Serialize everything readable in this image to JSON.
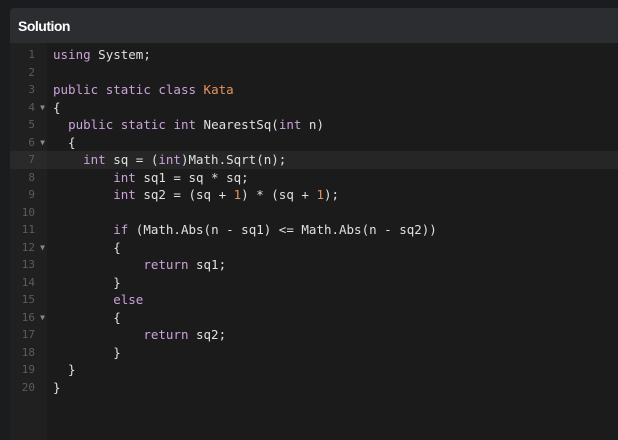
{
  "panel": {
    "title": "Solution"
  },
  "colors": {
    "keyword": "#c9a3d9",
    "class_name": "#e8935b",
    "number": "#e8935b",
    "text": "#e0e0e0",
    "gutter_number": "#5c5c5c"
  },
  "lines": [
    {
      "n": "1",
      "fold": false,
      "tokens": [
        [
          "kw",
          "using"
        ],
        [
          "plain",
          " System;"
        ]
      ]
    },
    {
      "n": "2",
      "fold": false,
      "tokens": []
    },
    {
      "n": "3",
      "fold": false,
      "tokens": [
        [
          "kw",
          "public"
        ],
        [
          "plain",
          " "
        ],
        [
          "kw",
          "static"
        ],
        [
          "plain",
          " "
        ],
        [
          "kw",
          "class"
        ],
        [
          "plain",
          " "
        ],
        [
          "cls",
          "Kata"
        ]
      ]
    },
    {
      "n": "4",
      "fold": true,
      "tokens": [
        [
          "plain",
          "{"
        ]
      ]
    },
    {
      "n": "5",
      "fold": false,
      "tokens": [
        [
          "plain",
          "  "
        ],
        [
          "kw",
          "public"
        ],
        [
          "plain",
          " "
        ],
        [
          "kw",
          "static"
        ],
        [
          "plain",
          " "
        ],
        [
          "kw",
          "int"
        ],
        [
          "plain",
          " NearestSq("
        ],
        [
          "kw",
          "int"
        ],
        [
          "plain",
          " n)"
        ]
      ]
    },
    {
      "n": "6",
      "fold": true,
      "tokens": [
        [
          "plain",
          "  {"
        ]
      ]
    },
    {
      "n": "7",
      "fold": false,
      "active": true,
      "tokens": [
        [
          "plain",
          "    "
        ],
        [
          "kw",
          "int"
        ],
        [
          "plain",
          " sq = ("
        ],
        [
          "kw",
          "int"
        ],
        [
          "plain",
          ")Math.Sqrt(n);"
        ]
      ]
    },
    {
      "n": "8",
      "fold": false,
      "tokens": [
        [
          "plain",
          "        "
        ],
        [
          "kw",
          "int"
        ],
        [
          "plain",
          " sq1 = sq * sq;"
        ]
      ]
    },
    {
      "n": "9",
      "fold": false,
      "tokens": [
        [
          "plain",
          "        "
        ],
        [
          "kw",
          "int"
        ],
        [
          "plain",
          " sq2 = (sq + "
        ],
        [
          "num-lit",
          "1"
        ],
        [
          "plain",
          ") * (sq + "
        ],
        [
          "num-lit",
          "1"
        ],
        [
          "plain",
          ");"
        ]
      ]
    },
    {
      "n": "10",
      "fold": false,
      "tokens": []
    },
    {
      "n": "11",
      "fold": false,
      "tokens": [
        [
          "plain",
          "        "
        ],
        [
          "kw",
          "if"
        ],
        [
          "plain",
          " (Math.Abs(n - sq1) <= Math.Abs(n - sq2))"
        ]
      ]
    },
    {
      "n": "12",
      "fold": true,
      "tokens": [
        [
          "plain",
          "        {"
        ]
      ]
    },
    {
      "n": "13",
      "fold": false,
      "tokens": [
        [
          "plain",
          "            "
        ],
        [
          "kw",
          "return"
        ],
        [
          "plain",
          " sq1;"
        ]
      ]
    },
    {
      "n": "14",
      "fold": false,
      "tokens": [
        [
          "plain",
          "        }"
        ]
      ]
    },
    {
      "n": "15",
      "fold": false,
      "tokens": [
        [
          "plain",
          "        "
        ],
        [
          "kw",
          "else"
        ]
      ]
    },
    {
      "n": "16",
      "fold": true,
      "tokens": [
        [
          "plain",
          "        {"
        ]
      ]
    },
    {
      "n": "17",
      "fold": false,
      "tokens": [
        [
          "plain",
          "            "
        ],
        [
          "kw",
          "return"
        ],
        [
          "plain",
          " sq2;"
        ]
      ]
    },
    {
      "n": "18",
      "fold": false,
      "tokens": [
        [
          "plain",
          "        }"
        ]
      ]
    },
    {
      "n": "19",
      "fold": false,
      "tokens": [
        [
          "plain",
          "  }"
        ]
      ]
    },
    {
      "n": "20",
      "fold": false,
      "tokens": [
        [
          "plain",
          "}"
        ]
      ]
    }
  ]
}
